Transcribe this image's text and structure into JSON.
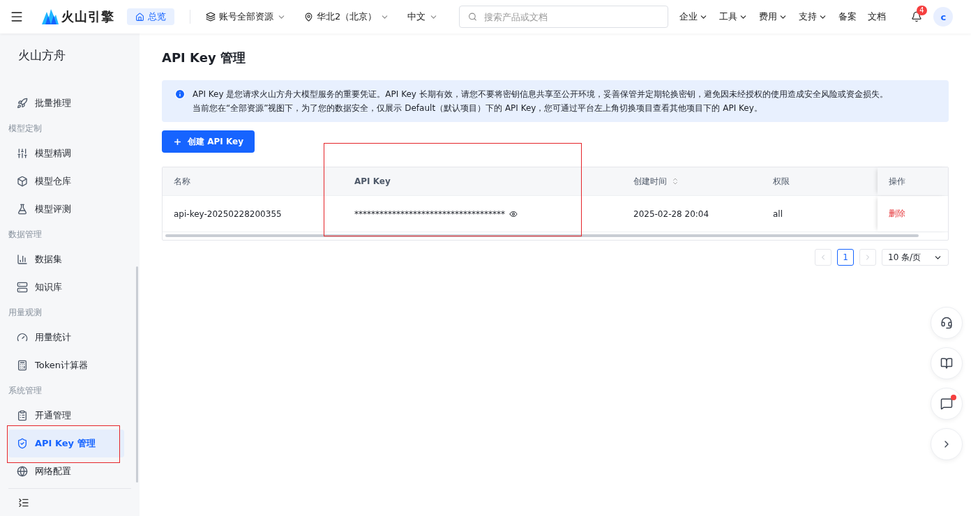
{
  "header": {
    "brand": "火山引擎",
    "nav": [
      {
        "label": "总览",
        "selected": true
      }
    ],
    "selectors": [
      {
        "label": "账号全部资源",
        "kind": "stack"
      },
      {
        "label": "华北2（北京）",
        "kind": "pin"
      },
      {
        "label": "中文",
        "kind": "plain"
      }
    ],
    "search": {
      "placeholder": "搜索产品或文档"
    },
    "menus": [
      {
        "label": "企业",
        "dropdown": true
      },
      {
        "label": "工具",
        "dropdown": true
      },
      {
        "label": "费用",
        "dropdown": true
      },
      {
        "label": "支持",
        "dropdown": true
      },
      {
        "label": "备案",
        "dropdown": false
      },
      {
        "label": "文档",
        "dropdown": false
      }
    ],
    "notifications": "4",
    "avatar": "c"
  },
  "sidebar": {
    "title": "火山方舟",
    "items": [
      {
        "kind": "item",
        "label": "批量推理",
        "selected": false,
        "highlighted": false
      },
      {
        "kind": "group",
        "label": "模型定制"
      },
      {
        "kind": "item",
        "label": "模型精调",
        "selected": false,
        "highlighted": false
      },
      {
        "kind": "item",
        "label": "模型仓库",
        "selected": false,
        "highlighted": false
      },
      {
        "kind": "item",
        "label": "模型评测",
        "selected": false,
        "highlighted": false
      },
      {
        "kind": "group",
        "label": "数据管理"
      },
      {
        "kind": "item",
        "label": "数据集",
        "selected": false,
        "highlighted": false
      },
      {
        "kind": "item",
        "label": "知识库",
        "selected": false,
        "highlighted": false
      },
      {
        "kind": "group",
        "label": "用量观测"
      },
      {
        "kind": "item",
        "label": "用量统计",
        "selected": false,
        "highlighted": false
      },
      {
        "kind": "item",
        "label": "Token计算器",
        "selected": false,
        "highlighted": false
      },
      {
        "kind": "group",
        "label": "系统管理"
      },
      {
        "kind": "item",
        "label": "开通管理",
        "selected": false,
        "highlighted": false
      },
      {
        "kind": "item",
        "label": "API Key 管理",
        "selected": true,
        "highlighted": true
      },
      {
        "kind": "item",
        "label": "网络配置",
        "selected": false,
        "highlighted": false
      }
    ]
  },
  "page": {
    "title": "API Key 管理",
    "notice": [
      "API Key 是您请求火山方舟大模型服务的重要凭证。API Key 长期有效，请您不要将密钥信息共享至公开环境，妥善保管并定期轮换密钥，避免因未经授权的使用造成安全风险或资金损失。",
      "当前您在“全部资源”视图下，为了您的数据安全，仅展示 Default（默认项目）下的 API Key，您可通过平台左上角切换项目查看其他项目下的 API Key。"
    ],
    "create_button": "创建 API Key",
    "table": {
      "columns": [
        {
          "label": "名称",
          "sortable": false,
          "highlighted": false
        },
        {
          "label": "API Key",
          "sortable": false,
          "highlighted": true
        },
        {
          "label": "创建时间",
          "sortable": true,
          "highlighted": false
        },
        {
          "label": "权限",
          "sortable": false,
          "highlighted": false
        },
        {
          "label": "操作",
          "sortable": false,
          "highlighted": false
        }
      ],
      "rows": [
        {
          "name": "api-key-20250228200355",
          "key": "************************************",
          "created": "2025-02-28 20:04",
          "permission": "all",
          "action": "删除"
        }
      ]
    },
    "pagination": {
      "pages": [
        {
          "label": "1",
          "selected": true
        }
      ],
      "page_size": "10 条/页"
    }
  }
}
